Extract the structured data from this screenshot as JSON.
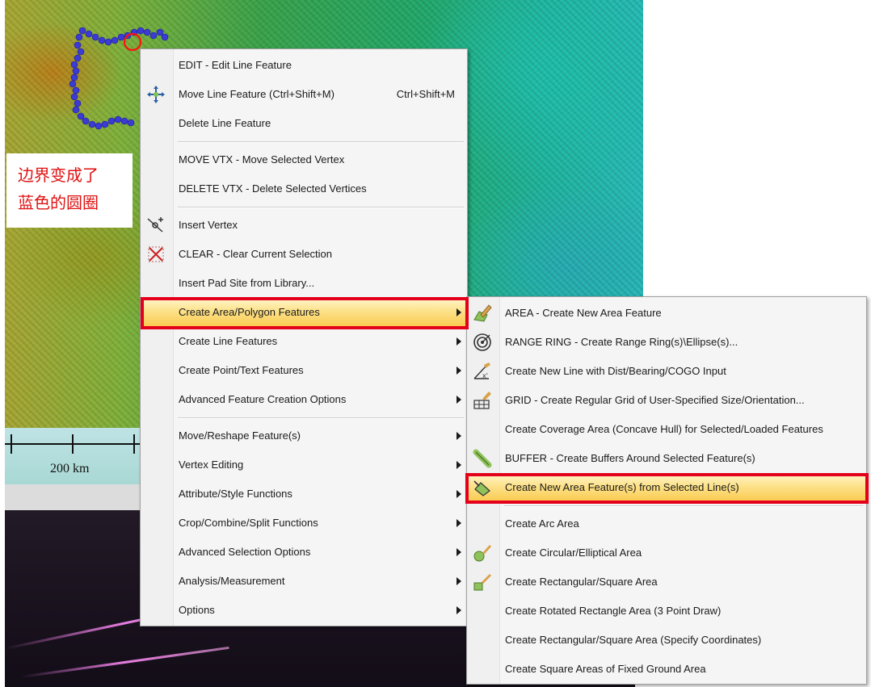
{
  "map": {
    "scale_label": "200 km"
  },
  "annotation": {
    "line1": "边界变成了",
    "line2": "蓝色的圆圈"
  },
  "main_menu": {
    "items": [
      {
        "label": "EDIT - Edit Line Feature",
        "icon": null
      },
      {
        "label": "Move Line Feature (Ctrl+Shift+M)",
        "shortcut": "Ctrl+Shift+M",
        "icon": "move-arrows-icon"
      },
      {
        "label": "Delete Line Feature",
        "icon": null
      },
      {
        "label": "MOVE VTX - Move Selected Vertex",
        "icon": null
      },
      {
        "label": "DELETE VTX - Delete Selected Vertices",
        "icon": null
      },
      {
        "label": "Insert Vertex",
        "icon": "insert-vertex-icon"
      },
      {
        "label": "CLEAR - Clear Current Selection",
        "icon": "clear-selection-icon"
      },
      {
        "label": "Insert Pad Site from Library...",
        "icon": null
      },
      {
        "label": "Create Area/Polygon Features",
        "submenu": true,
        "highlighted": true
      },
      {
        "label": "Create Line Features",
        "submenu": true
      },
      {
        "label": "Create Point/Text Features",
        "submenu": true
      },
      {
        "label": "Advanced Feature Creation Options",
        "submenu": true
      },
      {
        "label": "Move/Reshape Feature(s)",
        "submenu": true
      },
      {
        "label": "Vertex Editing",
        "submenu": true
      },
      {
        "label": "Attribute/Style Functions",
        "submenu": true
      },
      {
        "label": "Crop/Combine/Split Functions",
        "submenu": true
      },
      {
        "label": "Advanced Selection Options",
        "submenu": true
      },
      {
        "label": "Analysis/Measurement",
        "submenu": true
      },
      {
        "label": "Options",
        "submenu": true
      }
    ]
  },
  "sub_menu": {
    "items": [
      {
        "label": "AREA - Create New Area Feature",
        "icon": "area-pencil-icon"
      },
      {
        "label": "RANGE RING - Create Range Ring(s)\\Ellipse(s)...",
        "icon": "range-ring-icon"
      },
      {
        "label": "Create New Line with Dist/Bearing/COGO Input",
        "icon": "cogo-line-icon"
      },
      {
        "label": "GRID - Create Regular Grid of User-Specified Size/Orientation...",
        "icon": "grid-icon"
      },
      {
        "label": "Create Coverage Area (Concave Hull) for Selected/Loaded Features",
        "icon": null
      },
      {
        "label": "BUFFER - Create Buffers Around Selected Feature(s)",
        "icon": "buffer-icon"
      },
      {
        "label": "Create New Area Feature(s) from Selected Line(s)",
        "icon": "area-from-line-icon",
        "highlighted": true
      },
      {
        "label": "Create Arc Area",
        "icon": null
      },
      {
        "label": "Create Circular/Elliptical Area",
        "icon": "circle-area-icon"
      },
      {
        "label": "Create Rectangular/Square Area",
        "icon": "rectangle-area-icon"
      },
      {
        "label": "Create Rotated Rectangle Area (3 Point Draw)",
        "icon": null
      },
      {
        "label": "Create Rectangular/Square Area (Specify Coordinates)",
        "icon": null
      },
      {
        "label": "Create Square Areas of Fixed Ground Area",
        "icon": null
      }
    ]
  },
  "colors": {
    "highlight_box": "#e4001b",
    "annotation_text": "#e01010",
    "boundary_dots": "#3b3bd6"
  }
}
